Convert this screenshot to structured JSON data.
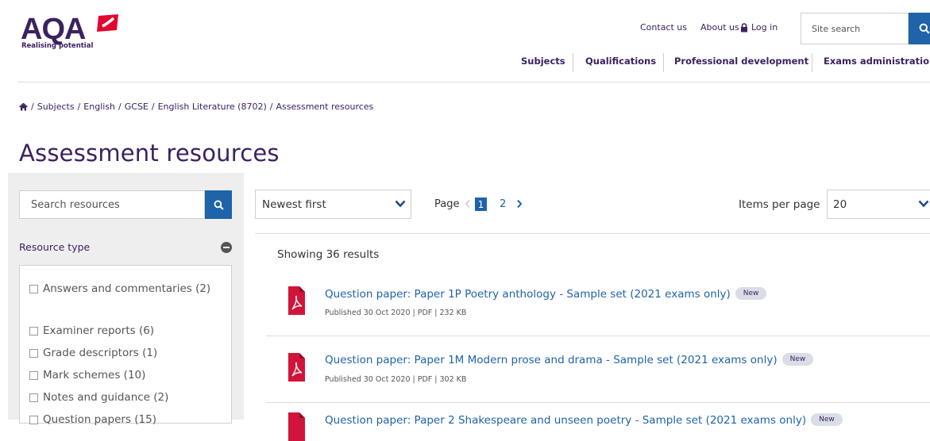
{
  "header": {
    "logo_text": "AQA",
    "logo_tagline": "Realising potential",
    "utility_links": [
      "Contact us",
      "About us",
      "Log in"
    ],
    "site_search_placeholder": "Site search",
    "nav": [
      "Subjects",
      "Qualifications",
      "Professional development",
      "Exams administration"
    ]
  },
  "breadcrumb": [
    "Subjects",
    "English",
    "GCSE",
    "English Literature (8702)",
    "Assessment resources"
  ],
  "page_title": "Assessment resources",
  "sidebar": {
    "search_placeholder": "Search resources",
    "facet_title": "Resource type",
    "options": [
      "Answers and commentaries (2)",
      "Examiner reports (6)",
      "Grade descriptors (1)",
      "Mark schemes (10)",
      "Notes and guidance (2)",
      "Question papers (15)"
    ]
  },
  "toolbar": {
    "sort_value": "Newest first",
    "page_label": "Page",
    "pages": [
      "1",
      "2"
    ],
    "items_per_page_label": "Items per page",
    "items_per_page_value": "20"
  },
  "results": {
    "showing": "Showing 36 results",
    "items": [
      {
        "title": "Question paper: Paper 1P Poetry anthology - Sample set (2021 exams only)",
        "badge": "New",
        "meta": "Published 30 Oct 2020 | PDF | 232 KB"
      },
      {
        "title": "Question paper: Paper 1M Modern prose and drama - Sample set (2021 exams only)",
        "badge": "New",
        "meta": "Published 30 Oct 2020 | PDF | 302 KB"
      },
      {
        "title": "Question paper: Paper 2 Shakespeare and unseen poetry - Sample set (2021 exams only)",
        "badge": "New",
        "meta": ""
      }
    ]
  },
  "colors": {
    "brand_purple": "#3b2161",
    "accent_blue": "#1f63a8",
    "logo_red": "#e4032e",
    "pdf_red": "#d2143a"
  },
  "icons": [
    "home-icon",
    "lock-icon",
    "search-icon",
    "minus-circle-icon",
    "chevron-down-icon",
    "chevron-right-icon",
    "chevron-left-icon",
    "pdf-icon"
  ]
}
